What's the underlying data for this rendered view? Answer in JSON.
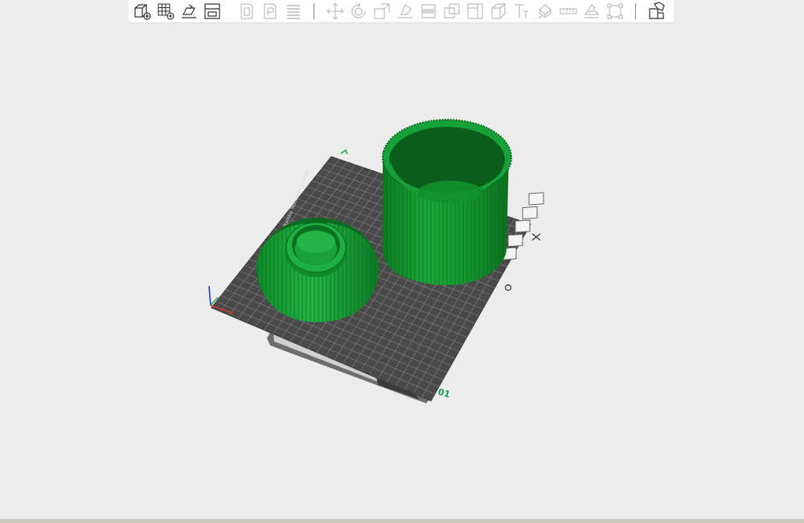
{
  "toolbar": {
    "groups": [
      [
        "add-object-icon",
        "arrange-grid-icon",
        "auto-orient-icon",
        "split-plate-icon"
      ],
      [
        "layer-view-icon",
        "paint-brush-icon",
        "stack-layers-icon"
      ],
      [
        "move-icon",
        "rotate-icon",
        "scale-icon",
        "lay-on-face-icon",
        "cut-icon",
        "boolean-icon",
        "mesh-split-icon",
        "support-paint-icon",
        "text-tool-icon",
        "seam-paint-icon",
        "measure-icon",
        "assembly-icon",
        "bounding-box-icon"
      ],
      [
        "explode-icon"
      ]
    ]
  },
  "viewport": {
    "plate_number_label": "01",
    "bed_brand_text": "Bambu Smooth PEI Plate",
    "bed_side_text": "Bambu Textured PEI Plate",
    "plate_button_icons": [
      "close-icon",
      "arrange-icon",
      "orient-icon",
      "lock-icon",
      "settings-icon"
    ],
    "object_color": "#1f9e3a",
    "bed_color": "#4a4a4a"
  }
}
